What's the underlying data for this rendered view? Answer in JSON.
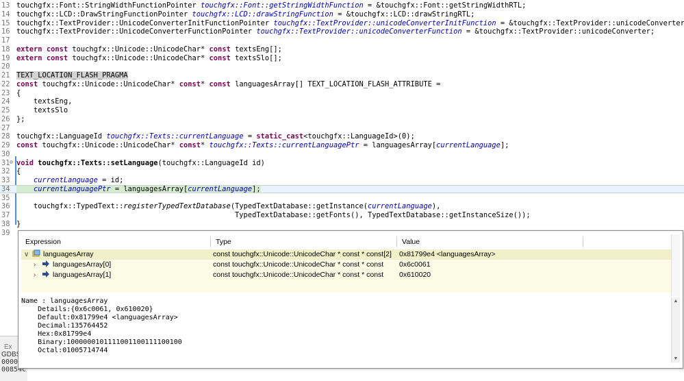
{
  "editor": {
    "lines": [
      {
        "n": "13",
        "t": "touchgfx::Font::StringWidthFunctionPointer touchgfx::Font::getStringWidthFunction = &touchgfx::Font::getStringWidthRTL;"
      },
      {
        "n": "14",
        "t": "touchgfx::LCD::DrawStringFunctionPointer touchgfx::LCD::drawStringFunction = &touchgfx::LCD::drawStringRTL;"
      },
      {
        "n": "15",
        "t": "touchgfx::TextProvider::UnicodeConverterInitFunctionPointer touchgfx::TextProvider::unicodeConverterInitFunction = &touchgfx::TextProvider::unicodeConverterInit;"
      },
      {
        "n": "16",
        "t": "touchgfx::TextProvider::UnicodeConverterFunctionPointer touchgfx::TextProvider::unicodeConverterFunction = &touchgfx::TextProvider::unicodeConverter;"
      },
      {
        "n": "17",
        "t": ""
      },
      {
        "n": "18",
        "t": "extern const touchgfx::Unicode::UnicodeChar* const textsEng[];"
      },
      {
        "n": "19",
        "t": "extern const touchgfx::Unicode::UnicodeChar* const textsSlo[];"
      },
      {
        "n": "20",
        "t": ""
      },
      {
        "n": "21",
        "t": "TEXT_LOCATION_FLASH_PRAGMA"
      },
      {
        "n": "22",
        "t": "const touchgfx::Unicode::UnicodeChar* const* const languagesArray[] TEXT_LOCATION_FLASH_ATTRIBUTE ="
      },
      {
        "n": "23",
        "t": "{"
      },
      {
        "n": "24",
        "t": "    textsEng,"
      },
      {
        "n": "25",
        "t": "    textsSlo"
      },
      {
        "n": "26",
        "t": "};"
      },
      {
        "n": "27",
        "t": ""
      },
      {
        "n": "28",
        "t": "touchgfx::LanguageId touchgfx::Texts::currentLanguage = static_cast<touchgfx::LanguageId>(0);"
      },
      {
        "n": "29",
        "t": "const touchgfx::Unicode::UnicodeChar* const* touchgfx::Texts::currentLanguagePtr = languagesArray[currentLanguage];"
      },
      {
        "n": "30",
        "t": ""
      },
      {
        "n": "31",
        "t": "void touchgfx::Texts::setLanguage(touchgfx::LanguageId id)"
      },
      {
        "n": "32",
        "t": "{"
      },
      {
        "n": "33",
        "t": "    currentLanguage = id;"
      },
      {
        "n": "34",
        "t": "    currentLanguagePtr = languagesArray[currentLanguage];"
      },
      {
        "n": "35",
        "t": ""
      },
      {
        "n": "36",
        "t": "    touchgfx::TypedText::registerTypedTextDatabase(TypedTextDatabase::getInstance(currentLanguage),"
      },
      {
        "n": "37",
        "t": "                                                   TypedTextDatabase::getFonts(), TypedTextDatabase::getInstanceSize());"
      },
      {
        "n": "38",
        "t": "}"
      },
      {
        "n": "39",
        "t": ""
      }
    ]
  },
  "bottom_panel": {
    "tab_label": "Ex",
    "line1": "GDBSe",
    "line2": "00000",
    "line3": "00854C)"
  },
  "hover": {
    "columns": {
      "expression": "Expression",
      "type": "Type",
      "value": "Value"
    },
    "rows": [
      {
        "expr": "languagesArray",
        "type": "const touchgfx::Unicode::UnicodeChar * const * const[2]",
        "value": "0x81799e4 <languagesArray>",
        "expanded": true
      },
      {
        "expr": "languagesArray[0]",
        "type": "const touchgfx::Unicode::UnicodeChar * const * const",
        "value": "0x6c0061"
      },
      {
        "expr": "languagesArray[1]",
        "type": "const touchgfx::Unicode::UnicodeChar * const * const",
        "value": "0x610020"
      }
    ],
    "details": "Name : languagesArray\n    Details:{0x6c0061, 0x610020}\n    Default:0x81799e4 <languagesArray>\n    Decimal:135764452\n    Hex:0x81799e4\n    Binary:1000000101111001100111100100\n    Octal:01005714744"
  }
}
